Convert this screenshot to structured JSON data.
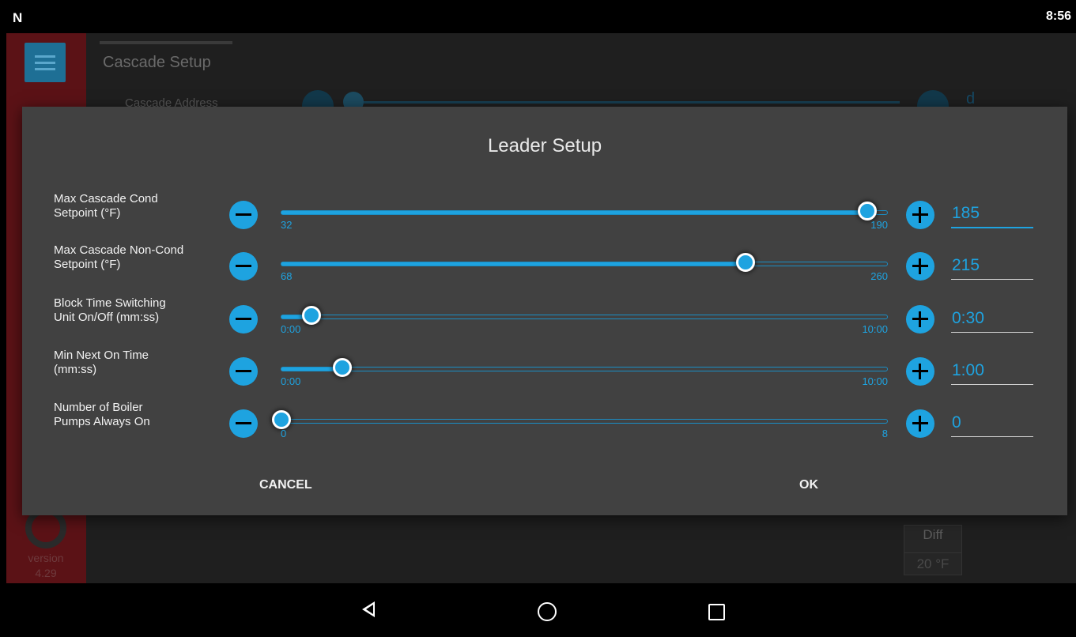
{
  "status_bar": {
    "notification_glyph": "N",
    "time": "8:56"
  },
  "app": {
    "title": "Cascade Setup",
    "background_row_label": "Cascade Address",
    "background_value": "d",
    "version_label": "version",
    "version_number": "4.29",
    "diff_label": "Diff",
    "diff_value": "20 °F"
  },
  "dialog": {
    "title": "Leader Setup",
    "rows": [
      {
        "label_line1": "Max Cascade Cond",
        "label_line2": "Setpoint (°F)",
        "min": "32",
        "max": "190",
        "value": "185",
        "fraction": 0.968
      },
      {
        "label_line1": "Max Cascade Non-Cond",
        "label_line2": "Setpoint (°F)",
        "min": "68",
        "max": "260",
        "value": "215",
        "fraction": 0.766
      },
      {
        "label_line1": "Block Time Switching",
        "label_line2": "Unit On/Off (mm:ss)",
        "min": "0:00",
        "max": "10:00",
        "value": "0:30",
        "fraction": 0.05
      },
      {
        "label_line1": "Min Next On Time",
        "label_line2": "(mm:ss)",
        "min": "0:00",
        "max": "10:00",
        "value": "1:00",
        "fraction": 0.1
      },
      {
        "label_line1": "Number of Boiler",
        "label_line2": "Pumps Always On",
        "min": "0",
        "max": "8",
        "value": "0",
        "fraction": 0.0
      }
    ],
    "cancel_label": "CANCEL",
    "ok_label": "OK"
  },
  "colors": {
    "accent": "#1ea3e0",
    "dialog_bg": "#414141",
    "side_panel": "#5b1216"
  },
  "icons": [
    "minus-circle-icon",
    "plus-circle-icon",
    "menu-icon",
    "gear-icon",
    "back-icon",
    "home-icon",
    "recents-icon"
  ]
}
